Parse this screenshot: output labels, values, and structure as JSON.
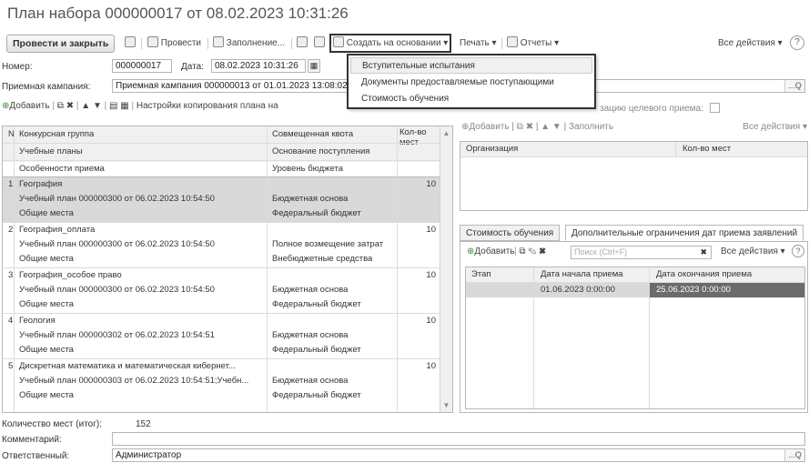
{
  "window": {
    "title": "План набора 000000017 от 08.02.2023 10:31:26"
  },
  "toolbar": {
    "post_close": "Провести и закрыть",
    "post": "Провести",
    "fill": "Заполнение...",
    "create_based": "Создать на основании",
    "print": "Печать",
    "reports": "Отчеты",
    "all_actions": "Все действия",
    "help": "?"
  },
  "dropdown": {
    "items": [
      "Вступительные испытания",
      "Документы предоставляемые поступающими",
      "Стоимость обучения"
    ]
  },
  "form": {
    "number_label": "Номер:",
    "number_value": "000000017",
    "date_label": "Дата:",
    "date_value": "08.02.2023 10:31:26",
    "campaign_label": "Приемная кампания:",
    "campaign_value": "Приемная кампания 000000013 от 01.01.2023 13:08:02",
    "target_label": "зацию целевого приема:",
    "total_label": "Количество мест (итог):",
    "total_value": "152",
    "comment_label": "Комментарий:",
    "comment_value": "",
    "responsible_label": "Ответственный:",
    "responsible_value": "Администратор"
  },
  "left_grid": {
    "add": "Добавить",
    "copy_settings": "Настройки копирования плана на",
    "headers": {
      "n": "N",
      "group": "Конкурсная группа",
      "quota": "Совмещенная квота",
      "count": "Кол-во мест",
      "plans": "Учебные планы",
      "basis": "Основание поступления",
      "features": "Особенности приема",
      "budget": "Уровень бюджета"
    },
    "rows": [
      {
        "n": "1",
        "group": "География",
        "count": "10",
        "plan": "Учебный план 000000300 от 06.02.2023 10:54:50",
        "basis": "Бюджетная основа",
        "features": "Общие места",
        "budget": "Федеральный бюджет"
      },
      {
        "n": "2",
        "group": "География_оплата",
        "count": "10",
        "plan": "Учебный план 000000300 от 06.02.2023 10:54:50",
        "basis": "Полное возмещение затрат",
        "features": "Общие места",
        "budget": "Внебюджетные средства"
      },
      {
        "n": "3",
        "group": "География_особое право",
        "count": "10",
        "plan": "Учебный план 000000300 от 06.02.2023 10:54:50",
        "basis": "Бюджетная основа",
        "features": "Общие места",
        "budget": "Федеральный бюджет"
      },
      {
        "n": "4",
        "group": "Геология",
        "count": "10",
        "plan": "Учебный план 000000302 от 06.02.2023 10:54:51",
        "basis": "Бюджетная основа",
        "features": "Общие места",
        "budget": "Федеральный бюджет"
      },
      {
        "n": "5",
        "group": "Дискретная математика и математическая кибернет...",
        "count": "10",
        "plan": "Учебный план 000000303 от 06.02.2023 10:54:51;Учебн...",
        "basis": "Бюджетная основа",
        "features": "Общие места",
        "budget": "Федеральный бюджет"
      }
    ]
  },
  "org_grid": {
    "add": "Добавить",
    "fill": "Заполнить",
    "all_actions": "Все действия",
    "col_org": "Организация",
    "col_count": "Кол-во мест"
  },
  "tabs": {
    "tab1": "Стоимость обучения",
    "tab2": "Дополнительные ограничения дат приема заявлений"
  },
  "dates_grid": {
    "add": "Добавить",
    "search_placeholder": "Поиск (Ctrl+F)",
    "all_actions": "Все действия",
    "col_stage": "Этап",
    "col_start": "Дата начала приема",
    "col_end": "Дата окончания приема",
    "row_start": "01.06.2023 0:00:00",
    "row_end": "25.06.2023 0:00:00"
  },
  "colors": {
    "selected_row": "#d9d9d9",
    "selected_cell": "#6b6b6b"
  }
}
